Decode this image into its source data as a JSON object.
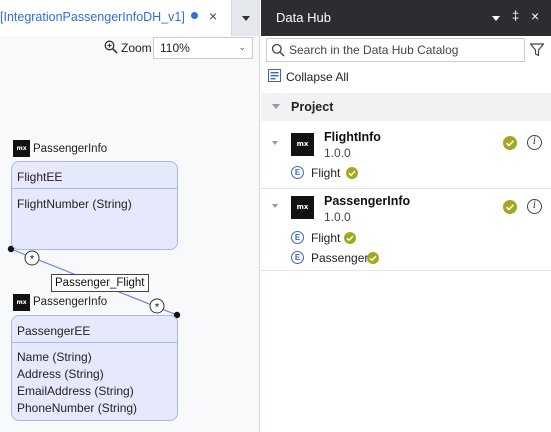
{
  "editor": {
    "tab_title": "[IntegrationPassengerInfoDH_v1]",
    "tab_close": "×",
    "zoom_label": "Zoom",
    "zoom_value": "110%"
  },
  "diagram": {
    "modules": [
      {
        "icon": "mx",
        "label": "PassengerInfo"
      },
      {
        "icon": "mx",
        "label": "PassengerInfo"
      }
    ],
    "entities": [
      {
        "name": "FlightEE",
        "attributes": [
          "FlightNumber (String)"
        ]
      },
      {
        "name": "PassengerEE",
        "attributes": [
          "Name (String)",
          "Address (String)",
          "EmailAddress (String)",
          "PhoneNumber (String)"
        ]
      }
    ],
    "association": {
      "label": "Passenger_Flight",
      "multiplicity_start": "*",
      "multiplicity_end": "*"
    }
  },
  "hub": {
    "title": "Data Hub",
    "pin": "‡",
    "close": "×",
    "search_placeholder": "Search in the Data Hub Catalog",
    "collapse_all": "Collapse All",
    "project_label": "Project",
    "modules": [
      {
        "icon": "mx",
        "name": "FlightInfo",
        "version": "1.0.0",
        "entities": [
          {
            "icon": "E",
            "label": "Flight"
          }
        ]
      },
      {
        "icon": "mx",
        "name": "PassengerInfo",
        "version": "1.0.0",
        "entities": [
          {
            "icon": "E",
            "label": "Flight"
          },
          {
            "icon": "E",
            "label": "Passenger"
          }
        ]
      }
    ]
  },
  "icons": {
    "zoom": "magnifier-plus-icon",
    "search": "search-icon",
    "filter": "filter-icon",
    "collapse": "collapse-all-icon",
    "check": "check-badge-icon",
    "info": "info-icon",
    "entity": "entity-icon",
    "module": "module-icon"
  },
  "colors": {
    "accent": "#2f6fd6",
    "hub_header": "#2c2c31",
    "entity_fill": "#e6e9fb",
    "entity_border": "#a7b8ee",
    "check_badge": "#a2a91f"
  }
}
